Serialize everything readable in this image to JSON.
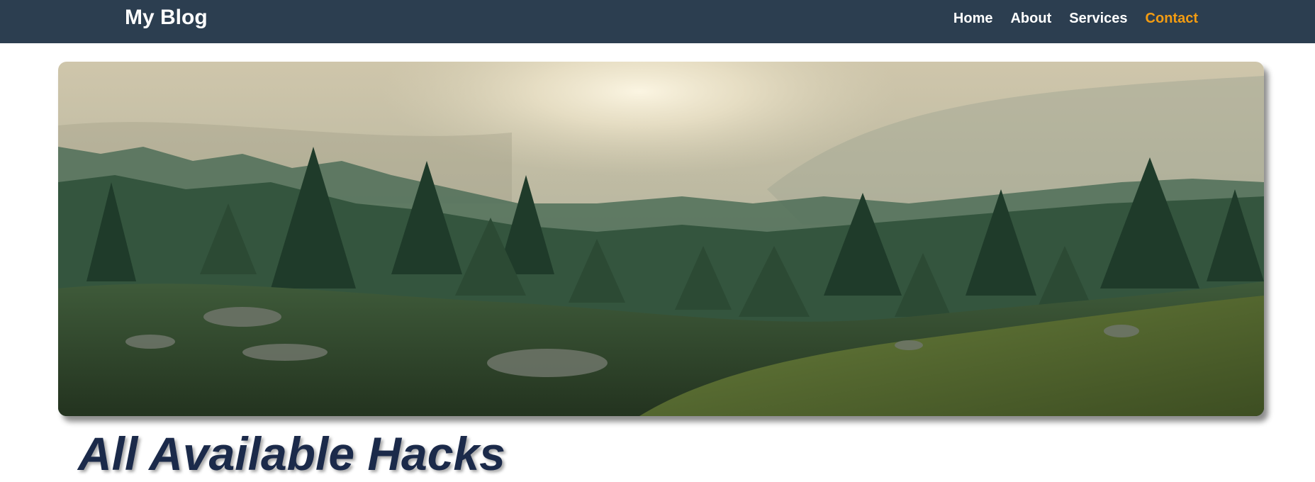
{
  "navbar": {
    "brand": "My Blog",
    "links": [
      {
        "label": "Home"
      },
      {
        "label": "About"
      },
      {
        "label": "Services"
      },
      {
        "label": "Contact",
        "active": true
      }
    ],
    "background": "#2c3e50",
    "active_color": "#f39c12"
  },
  "hero": {
    "image": "forest-landscape-image"
  },
  "main": {
    "heading": "All Available Hacks"
  }
}
